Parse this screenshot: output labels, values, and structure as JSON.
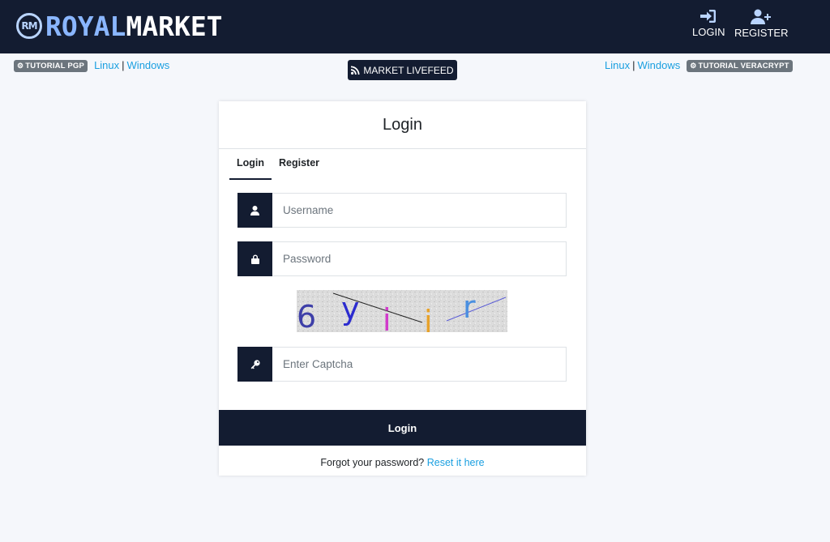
{
  "header": {
    "logo_badge": "RM",
    "logo_royal": "ROYAL",
    "logo_market": "MARKET",
    "nav": {
      "login_label": "LOGIN",
      "register_label": "REGISTER"
    }
  },
  "subbar": {
    "left": {
      "badge": "TUTORIAL PGP",
      "linux": "Linux",
      "separator": "|",
      "windows": "Windows"
    },
    "livefeed": "MARKET LIVEFEED",
    "right": {
      "linux": "Linux",
      "separator": "|",
      "windows": "Windows",
      "badge": "TUTORIAL VERACRYPT"
    }
  },
  "card": {
    "title": "Login",
    "tabs": [
      {
        "label": "Login",
        "active": true
      },
      {
        "label": "Register",
        "active": false
      }
    ],
    "fields": {
      "username_placeholder": "Username",
      "password_placeholder": "Password",
      "captcha_placeholder": "Enter Captcha"
    },
    "captcha_chars": [
      "6",
      "y",
      "i",
      "i",
      "r"
    ],
    "submit_label": "Login",
    "forgot_text": "Forgot your password?",
    "reset_link": "Reset it here"
  },
  "icons": {
    "login": "sign-in-icon",
    "register": "user-plus-icon",
    "rss": "rss-icon",
    "gear": "gear-icon",
    "user": "user-icon",
    "lock": "lock-icon",
    "key": "key-icon"
  },
  "colors": {
    "navy": "#131c31",
    "link": "#1a9fe0",
    "logo_accent": "#8ab6ff",
    "page_bg": "#f5f7fb",
    "badge_gray": "#6c757d"
  }
}
